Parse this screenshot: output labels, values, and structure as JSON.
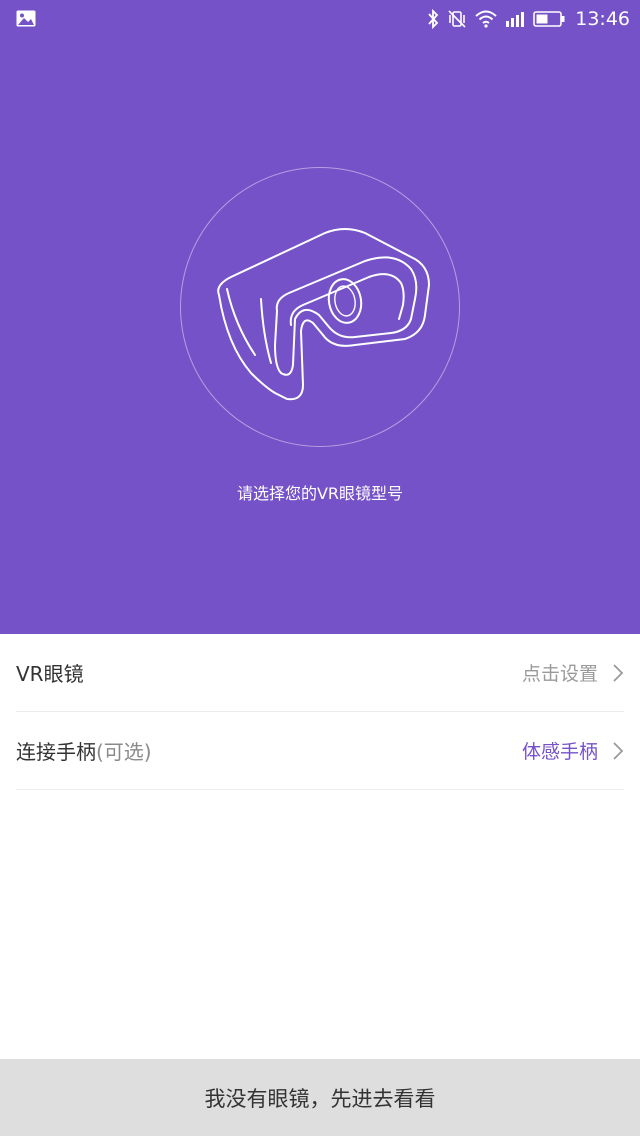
{
  "status_bar": {
    "time": "13:46",
    "icons": [
      "image-icon",
      "bluetooth-icon",
      "vibrate-icon",
      "wifi-icon",
      "signal-icon",
      "battery-icon"
    ]
  },
  "hero": {
    "background_color": "#7652c8",
    "illustration": "vr-headset-icon",
    "prompt": "请选择您的VR眼镜型号"
  },
  "settings": {
    "vr_glasses": {
      "label": "VR眼镜",
      "value": "点击设置"
    },
    "controller": {
      "label": "连接手柄",
      "optional": "(可选)",
      "value": "体感手柄"
    }
  },
  "bottom": {
    "skip_label": "我没有眼镜，先进去看看"
  },
  "colors": {
    "accent": "#7652c8",
    "bottom_bar": "#dedede"
  }
}
